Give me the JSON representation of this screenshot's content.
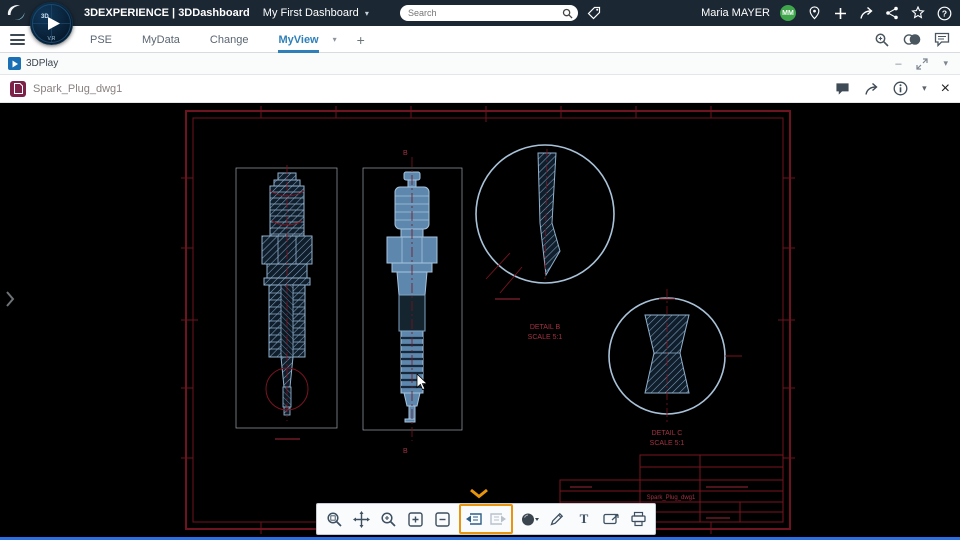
{
  "header": {
    "brand": "3DEXPERIENCE",
    "separator": "|",
    "app": "3DDashboard",
    "dashboard_name": "My First Dashboard",
    "search_placeholder": "Search",
    "user_name": "Maria MAYER",
    "avatar_initials": "MM",
    "compass": {
      "top_left": "3D",
      "bottom": "V.R"
    }
  },
  "glyphs": {
    "chevron_down": "▾",
    "close": "×",
    "minimize": "–",
    "plus": "+",
    "question": "?",
    "text_tool": "T"
  },
  "tabbar": {
    "items": [
      {
        "label": "PSE",
        "active": false
      },
      {
        "label": "MyData",
        "active": false
      },
      {
        "label": "Change",
        "active": false
      },
      {
        "label": "MyView",
        "active": true
      }
    ],
    "active_color": "#2F80B9"
  },
  "playbar": {
    "title": "3DPlay"
  },
  "docbar": {
    "title": "Spark_Plug_dwg1"
  },
  "viewer": {
    "toolbar_buttons": [
      "zoom-window",
      "pan",
      "zoom",
      "zoom-in",
      "zoom-out",
      "previous-sheet",
      "next-sheet",
      "render-style",
      "markup-pencil",
      "text",
      "slide",
      "print"
    ],
    "highlight_color": "#E8940C"
  },
  "drawing": {
    "section_marker": "B",
    "detail_b": {
      "title": "DETAIL  B",
      "scale": "SCALE  5:1"
    },
    "detail_c": {
      "title": "DETAIL  C",
      "scale": "SCALE  5:1"
    },
    "title_block_name": "Spark_Plug_dwg1",
    "colors": {
      "sheet_border": "#6E1420",
      "dimension_red": "#8B1A2A",
      "steel_blue": "#7FA3C2",
      "detail_circle": "#A9C2D8"
    }
  }
}
